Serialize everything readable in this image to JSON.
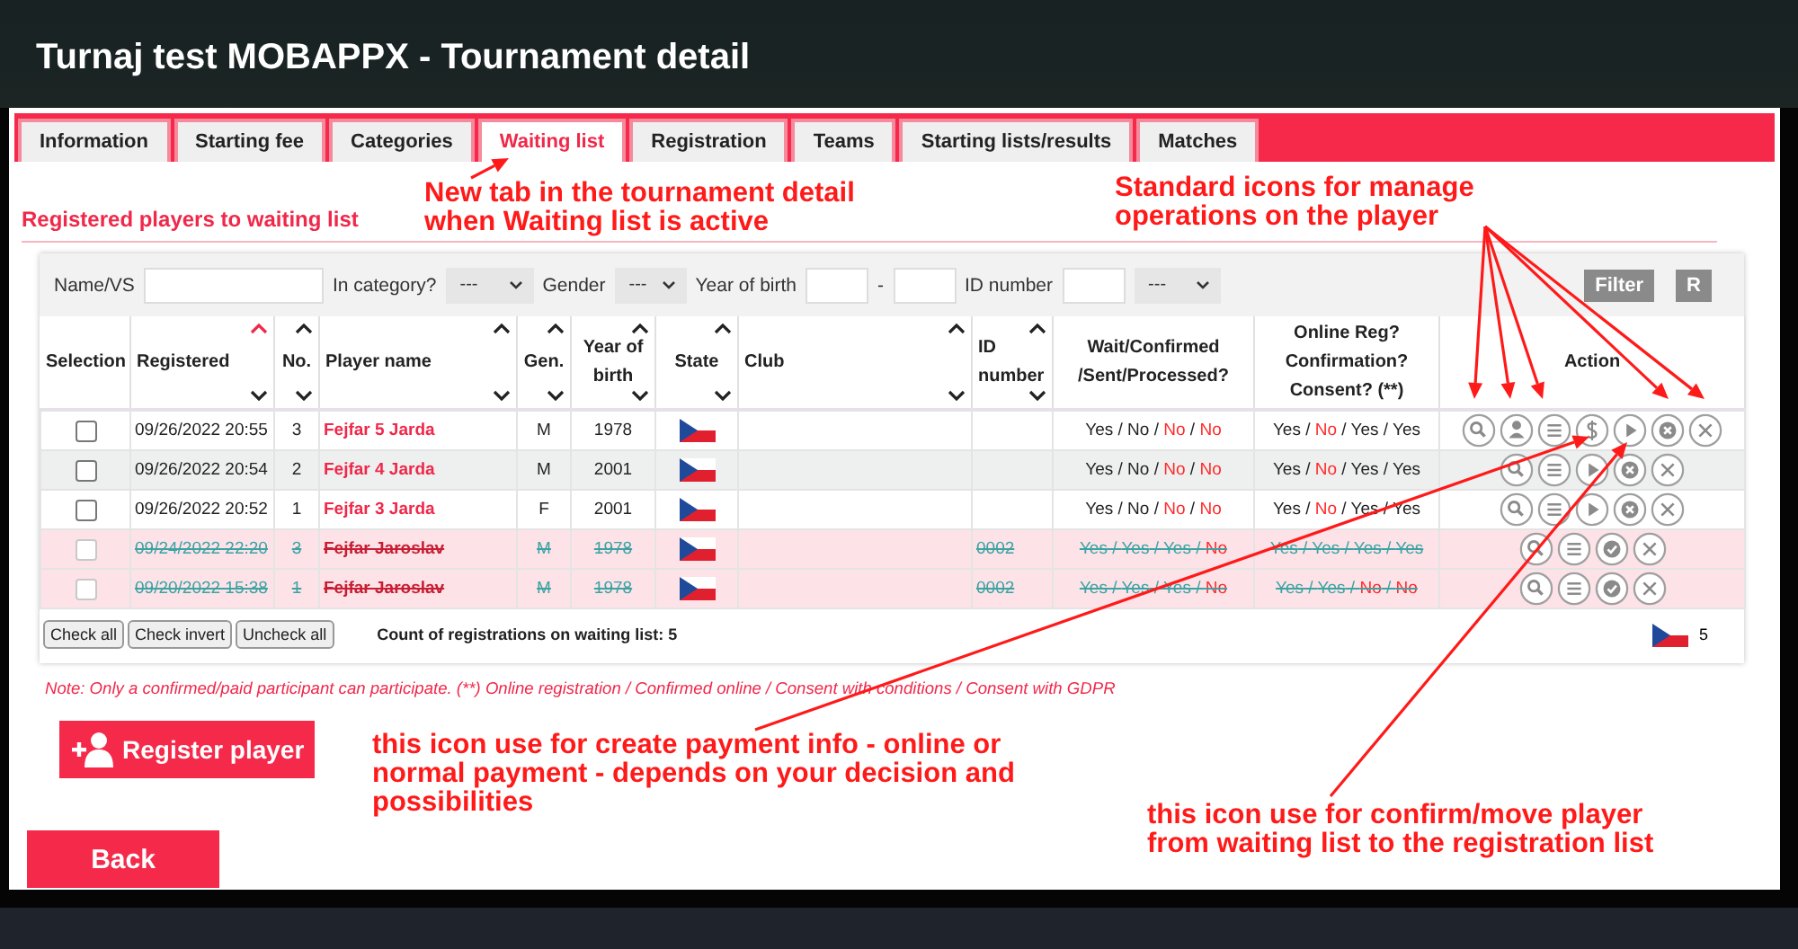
{
  "window": {
    "title": "Turnaj test MOBAPPX - Tournament detail"
  },
  "tabs": [
    {
      "label": "Information",
      "selected": false
    },
    {
      "label": "Starting fee",
      "selected": false
    },
    {
      "label": "Categories",
      "selected": false
    },
    {
      "label": "Waiting list",
      "selected": true
    },
    {
      "label": "Registration",
      "selected": false
    },
    {
      "label": "Teams",
      "selected": false
    },
    {
      "label": "Starting lists/results",
      "selected": false
    },
    {
      "label": "Matches",
      "selected": false
    }
  ],
  "section_title": "Registered players to waiting list",
  "filter": {
    "fields": [
      {
        "kind": "text",
        "label": "Name/VS"
      },
      {
        "kind": "select",
        "label": "In category?",
        "value": "---"
      },
      {
        "kind": "select",
        "label": "Gender",
        "value": "---"
      },
      {
        "kind": "range",
        "label": "Year of birth",
        "separator": "-"
      },
      {
        "kind": "text",
        "label": "ID number"
      },
      {
        "kind": "select",
        "value": "---"
      }
    ],
    "buttons": [
      "Filter",
      "R"
    ]
  },
  "table": {
    "status_separator": " / ",
    "columns": [
      {
        "label": "Selection",
        "sortable": false
      },
      {
        "label": "Registered",
        "sortable": true,
        "sorted": true
      },
      {
        "label": "No.",
        "sortable": true,
        "sorted": false
      },
      {
        "label": "Player name",
        "sortable": true,
        "sorted": false
      },
      {
        "label": "Gen.",
        "sortable": true,
        "sorted": false
      },
      {
        "label": "Year of birth",
        "sortable": true,
        "sorted": false
      },
      {
        "label": "State",
        "sortable": true,
        "sorted": false
      },
      {
        "label": "Club",
        "sortable": true,
        "sorted": false
      },
      {
        "label": "ID number",
        "sortable": true,
        "sorted": false
      },
      {
        "label": "Wait/Confirmed /Sent/Processed?",
        "sortable": false
      },
      {
        "label": "Online Reg? Confirmation? Consent? (**)",
        "sortable": false
      },
      {
        "label": "Action",
        "sortable": false
      }
    ],
    "rows": [
      {
        "checked": false,
        "cancelled": false,
        "registered": "09/26/2022 20:55",
        "no": "3",
        "player": "Fejfar 5 Jarda",
        "gender": "M",
        "year": "1978",
        "wait": [
          {
            "text": "Yes",
            "alert": false
          },
          {
            "text": "No",
            "alert": false
          },
          {
            "text": "No",
            "alert": true
          },
          {
            "text": "No",
            "alert": true
          }
        ],
        "online": [
          {
            "text": "Yes",
            "alert": false
          },
          {
            "text": "No",
            "alert": true
          },
          {
            "text": "Yes",
            "alert": false
          },
          {
            "text": "Yes",
            "alert": false
          }
        ],
        "actions": [
          {
            "kind": "search"
          },
          {
            "kind": "person"
          },
          {
            "kind": "list"
          },
          {
            "kind": "dollar"
          },
          {
            "kind": "play"
          },
          {
            "kind": "cancel"
          },
          {
            "kind": "close"
          }
        ]
      },
      {
        "checked": false,
        "cancelled": false,
        "registered": "09/26/2022 20:54",
        "no": "2",
        "player": "Fejfar 4 Jarda",
        "gender": "M",
        "year": "2001",
        "wait": [
          {
            "text": "Yes",
            "alert": false
          },
          {
            "text": "No",
            "alert": false
          },
          {
            "text": "No",
            "alert": true
          },
          {
            "text": "No",
            "alert": true
          }
        ],
        "online": [
          {
            "text": "Yes",
            "alert": false
          },
          {
            "text": "No",
            "alert": true
          },
          {
            "text": "Yes",
            "alert": false
          },
          {
            "text": "Yes",
            "alert": false
          }
        ],
        "actions": [
          {
            "kind": "search"
          },
          {
            "kind": "list"
          },
          {
            "kind": "play"
          },
          {
            "kind": "cancel"
          },
          {
            "kind": "close"
          }
        ]
      },
      {
        "checked": false,
        "cancelled": false,
        "registered": "09/26/2022 20:52",
        "no": "1",
        "player": "Fejfar 3 Jarda",
        "gender": "F",
        "year": "2001",
        "wait": [
          {
            "text": "Yes",
            "alert": false
          },
          {
            "text": "No",
            "alert": false
          },
          {
            "text": "No",
            "alert": true
          },
          {
            "text": "No",
            "alert": true
          }
        ],
        "online": [
          {
            "text": "Yes",
            "alert": false
          },
          {
            "text": "No",
            "alert": true
          },
          {
            "text": "Yes",
            "alert": false
          },
          {
            "text": "Yes",
            "alert": false
          }
        ],
        "actions": [
          {
            "kind": "search"
          },
          {
            "kind": "list"
          },
          {
            "kind": "play"
          },
          {
            "kind": "cancel"
          },
          {
            "kind": "close"
          }
        ]
      },
      {
        "checked": false,
        "cancelled": true,
        "registered": "09/24/2022 22:20",
        "no": "3",
        "player": "Fejfar Jaroslav",
        "gender": "M",
        "year": "1978",
        "id": "0002",
        "wait": [
          {
            "text": "Yes",
            "alert": false
          },
          {
            "text": "Yes",
            "alert": false
          },
          {
            "text": "Yes",
            "alert": false
          },
          {
            "text": "No",
            "alert": true
          }
        ],
        "online": [
          {
            "text": "Yes",
            "alert": false
          },
          {
            "text": "Yes",
            "alert": false
          },
          {
            "text": "Yes",
            "alert": false
          },
          {
            "text": "Yes",
            "alert": false
          }
        ],
        "actions": [
          {
            "kind": "search"
          },
          {
            "kind": "list"
          },
          {
            "kind": "check"
          },
          {
            "kind": "close"
          }
        ]
      },
      {
        "checked": false,
        "cancelled": true,
        "registered": "09/20/2022 15:38",
        "no": "1",
        "player": "Fejfar Jaroslav",
        "gender": "M",
        "year": "1978",
        "id": "0002",
        "wait": [
          {
            "text": "Yes",
            "alert": false
          },
          {
            "text": "Yes",
            "alert": false
          },
          {
            "text": "Yes",
            "alert": false
          },
          {
            "text": "No",
            "alert": true
          }
        ],
        "online": [
          {
            "text": "Yes",
            "alert": false
          },
          {
            "text": "Yes",
            "alert": false
          },
          {
            "text": "No",
            "alert": true
          },
          {
            "text": "No",
            "alert": true
          }
        ],
        "actions": [
          {
            "kind": "search"
          },
          {
            "kind": "list"
          },
          {
            "kind": "check"
          },
          {
            "kind": "close"
          }
        ]
      }
    ],
    "footer_buttons": [
      "Check all",
      "Check invert",
      "Uncheck all"
    ],
    "count_text": "Count of registrations on waiting list: 5",
    "state_count": "5"
  },
  "note": "Note: Only a confirmed/paid participant can participate. (**) Online registration / Confirmed online / Consent with conditions / Consent with GDPR",
  "register_button": "Register player",
  "back_button": "Back",
  "annotations": [
    {
      "lines": [
        "New tab in the tournament detail",
        "when Waiting list is active"
      ]
    },
    {
      "lines": [
        "Standard icons for manage",
        "operations on the player"
      ]
    },
    {
      "lines": [
        "this icon use for create payment info - online or",
        "normal payment - depends on your decision and",
        "possibilities"
      ]
    },
    {
      "lines": [
        "this icon use for confirm/move player",
        "from waiting list to the registration list"
      ]
    }
  ]
}
